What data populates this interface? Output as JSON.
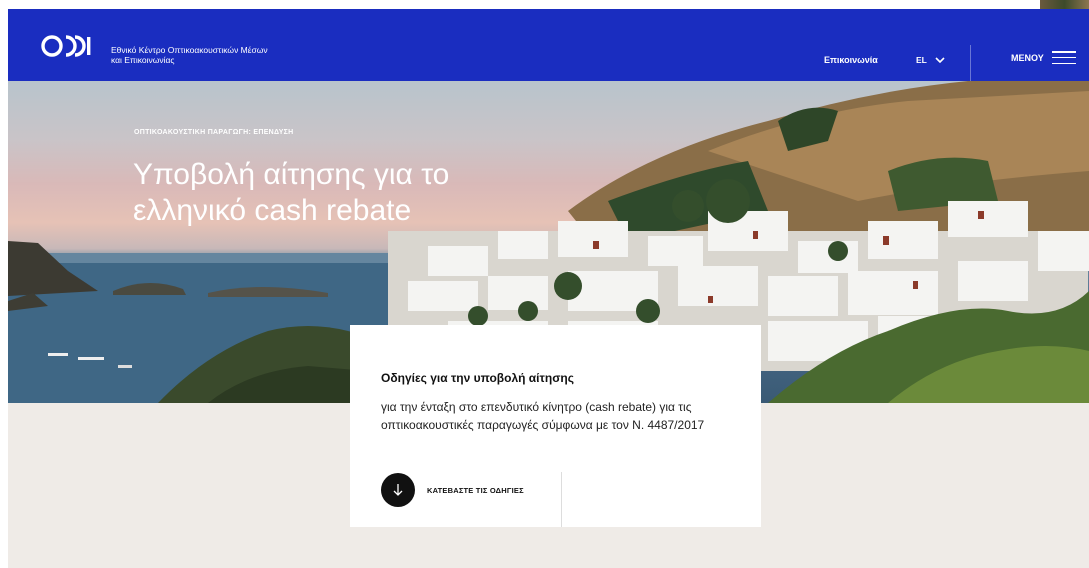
{
  "header": {
    "org_line1": "Εθνικό Κέντρο Οπτικοακουστικών Μέσων",
    "org_line2": "και Επικοινωνίας",
    "contact_label": "Επικοινωνία",
    "lang_label": "EL",
    "menu_label": "ΜΕΝΟΥ"
  },
  "hero": {
    "kicker": "ΟΠΤΙΚΟΑΚΟΥΣΤΙΚΗ ΠΑΡΑΓΩΓΗ: ΕΠΕΝΔΥΣΗ",
    "title_line1": "Υποβολή αίτησης για το",
    "title_line2": "ελληνικό cash rebate"
  },
  "card": {
    "title": "Οδηγίες για την υποβολή αίτησης",
    "text": "για την ένταξη στο επενδυτικό κίνητρο (cash rebate) για τις οπτικοακουστικές παραγωγές σύμφωνα με τον Ν. 4487/2017",
    "download_label": "ΚΑΤΕΒΑΣΤΕ ΤΙΣ ΟΔΗΓΙΕΣ"
  },
  "colors": {
    "brand_blue": "#1a2dc0",
    "beige": "#efebe7"
  },
  "icons": {
    "logo": "ekome-logo",
    "lang": "chevron-down-icon",
    "menu": "hamburger-icon",
    "download": "arrow-down-icon"
  }
}
